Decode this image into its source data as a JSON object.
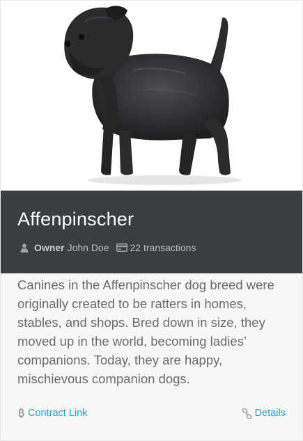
{
  "card": {
    "title": "Affenpinscher",
    "image_alt_icon": "dog-photo",
    "meta": {
      "owner_icon": "user-icon",
      "owner_label": "Owner",
      "owner_name": "John Doe",
      "transactions_icon": "credit-card-icon",
      "transactions_text": "22 transactions"
    },
    "description": "Canines in the Affenpinscher dog breed were originally created to be ratters in homes, stables, and shops. Bred down in size, they moved up in the world, becoming ladies’ companions. Today, they are happy, mischievous companion dogs.",
    "footer": {
      "contract_icon": "bitcoin-icon",
      "contract_label": "Contract Link",
      "details_icon": "link-icon",
      "details_label": "Details"
    }
  },
  "colors": {
    "header_bg": "#393e42",
    "link": "#2a9fd6",
    "body_text": "#6b6b6b"
  }
}
